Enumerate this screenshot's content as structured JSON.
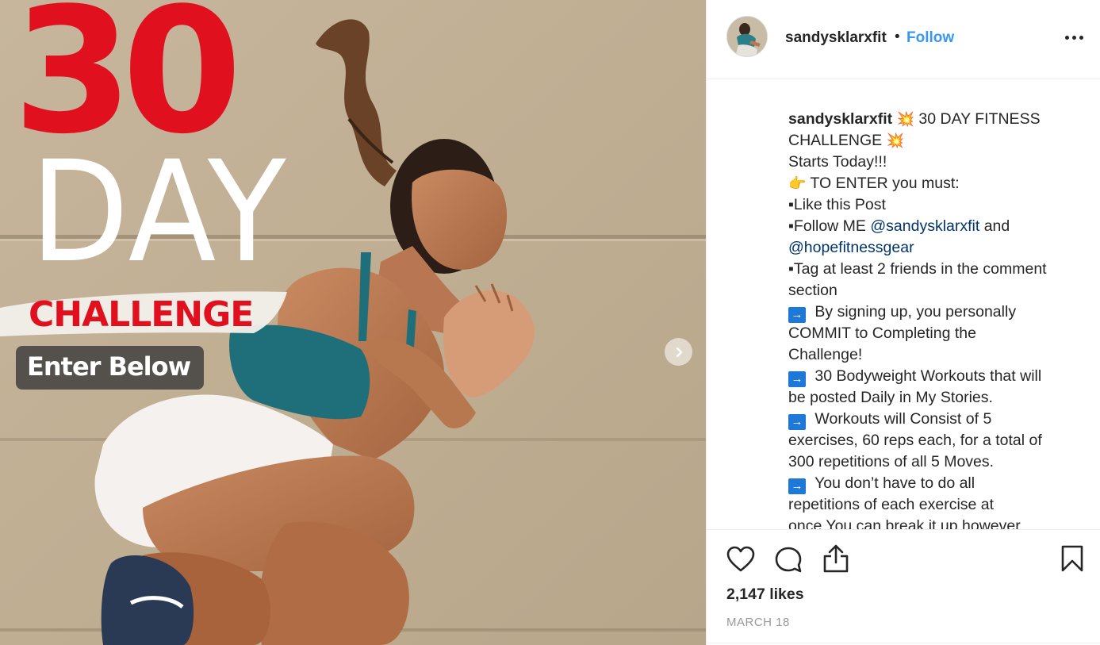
{
  "media": {
    "overlay_number": "30",
    "overlay_day": "DAY",
    "overlay_challenge": "CHALLENGE",
    "overlay_enter": "Enter Below",
    "next_icon": "chevron-right-icon",
    "colors": {
      "red": "#e0101f",
      "wall": "#c3b298"
    }
  },
  "header": {
    "username": "sandysklarxfit",
    "separator": "•",
    "follow_label": "Follow",
    "more_icon": "more-options-icon"
  },
  "caption": {
    "username": "sandysklarxfit",
    "lines": {
      "l1_text": " 30 DAY FITNESS",
      "l2_text": "CHALLENGE ",
      "l3": "Starts Today!!!",
      "l4_text": " TO ENTER you must:",
      "l5": "▪Like this Post",
      "l6_pre": "▪Follow ME ",
      "l6_mention": "@sandysklarxfit",
      "l6_post": " and",
      "l7_mention": "@hopefitnessgear",
      "l8": "▪Tag at least 2 friends in the comment",
      "l9": "section",
      "l10": " By signing up, you personally",
      "l11": "COMMIT to Completing the",
      "l12": "Challenge!",
      "l13": " 30 Bodyweight Workouts that will",
      "l14": "be posted Daily in My Stories.",
      "l15": " Workouts will Consist of 5",
      "l16": "exercises, 60 reps each, for a total of",
      "l17": "300 repetitions of all 5 Moves.",
      "l18": " You don’t have to do all",
      "l19": "repetitions of each exercise at",
      "l20": "once You can break it up however"
    },
    "emoji_boom": "💥",
    "emoji_hand": "👉",
    "arrow_glyph": "→"
  },
  "actions": {
    "like_icon": "heart-icon",
    "comment_icon": "comment-icon",
    "share_icon": "share-icon",
    "save_icon": "bookmark-icon",
    "likes": "2,147 likes",
    "date": "MARCH 18"
  }
}
